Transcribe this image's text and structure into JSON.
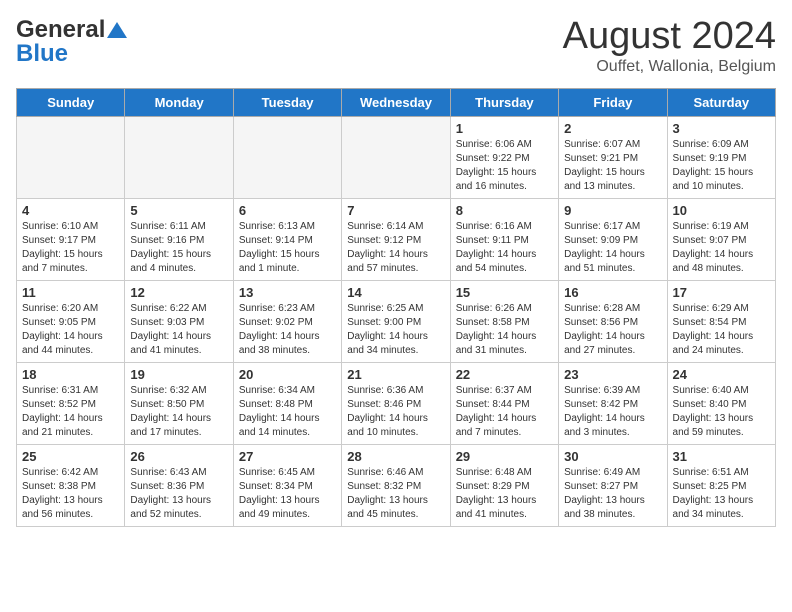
{
  "header": {
    "logo_general": "General",
    "logo_blue": "Blue",
    "month_title": "August 2024",
    "location": "Ouffet, Wallonia, Belgium"
  },
  "days_of_week": [
    "Sunday",
    "Monday",
    "Tuesday",
    "Wednesday",
    "Thursday",
    "Friday",
    "Saturday"
  ],
  "weeks": [
    [
      {
        "day": "",
        "info": ""
      },
      {
        "day": "",
        "info": ""
      },
      {
        "day": "",
        "info": ""
      },
      {
        "day": "",
        "info": ""
      },
      {
        "day": "1",
        "info": "Sunrise: 6:06 AM\nSunset: 9:22 PM\nDaylight: 15 hours\nand 16 minutes."
      },
      {
        "day": "2",
        "info": "Sunrise: 6:07 AM\nSunset: 9:21 PM\nDaylight: 15 hours\nand 13 minutes."
      },
      {
        "day": "3",
        "info": "Sunrise: 6:09 AM\nSunset: 9:19 PM\nDaylight: 15 hours\nand 10 minutes."
      }
    ],
    [
      {
        "day": "4",
        "info": "Sunrise: 6:10 AM\nSunset: 9:17 PM\nDaylight: 15 hours\nand 7 minutes."
      },
      {
        "day": "5",
        "info": "Sunrise: 6:11 AM\nSunset: 9:16 PM\nDaylight: 15 hours\nand 4 minutes."
      },
      {
        "day": "6",
        "info": "Sunrise: 6:13 AM\nSunset: 9:14 PM\nDaylight: 15 hours\nand 1 minute."
      },
      {
        "day": "7",
        "info": "Sunrise: 6:14 AM\nSunset: 9:12 PM\nDaylight: 14 hours\nand 57 minutes."
      },
      {
        "day": "8",
        "info": "Sunrise: 6:16 AM\nSunset: 9:11 PM\nDaylight: 14 hours\nand 54 minutes."
      },
      {
        "day": "9",
        "info": "Sunrise: 6:17 AM\nSunset: 9:09 PM\nDaylight: 14 hours\nand 51 minutes."
      },
      {
        "day": "10",
        "info": "Sunrise: 6:19 AM\nSunset: 9:07 PM\nDaylight: 14 hours\nand 48 minutes."
      }
    ],
    [
      {
        "day": "11",
        "info": "Sunrise: 6:20 AM\nSunset: 9:05 PM\nDaylight: 14 hours\nand 44 minutes."
      },
      {
        "day": "12",
        "info": "Sunrise: 6:22 AM\nSunset: 9:03 PM\nDaylight: 14 hours\nand 41 minutes."
      },
      {
        "day": "13",
        "info": "Sunrise: 6:23 AM\nSunset: 9:02 PM\nDaylight: 14 hours\nand 38 minutes."
      },
      {
        "day": "14",
        "info": "Sunrise: 6:25 AM\nSunset: 9:00 PM\nDaylight: 14 hours\nand 34 minutes."
      },
      {
        "day": "15",
        "info": "Sunrise: 6:26 AM\nSunset: 8:58 PM\nDaylight: 14 hours\nand 31 minutes."
      },
      {
        "day": "16",
        "info": "Sunrise: 6:28 AM\nSunset: 8:56 PM\nDaylight: 14 hours\nand 27 minutes."
      },
      {
        "day": "17",
        "info": "Sunrise: 6:29 AM\nSunset: 8:54 PM\nDaylight: 14 hours\nand 24 minutes."
      }
    ],
    [
      {
        "day": "18",
        "info": "Sunrise: 6:31 AM\nSunset: 8:52 PM\nDaylight: 14 hours\nand 21 minutes."
      },
      {
        "day": "19",
        "info": "Sunrise: 6:32 AM\nSunset: 8:50 PM\nDaylight: 14 hours\nand 17 minutes."
      },
      {
        "day": "20",
        "info": "Sunrise: 6:34 AM\nSunset: 8:48 PM\nDaylight: 14 hours\nand 14 minutes."
      },
      {
        "day": "21",
        "info": "Sunrise: 6:36 AM\nSunset: 8:46 PM\nDaylight: 14 hours\nand 10 minutes."
      },
      {
        "day": "22",
        "info": "Sunrise: 6:37 AM\nSunset: 8:44 PM\nDaylight: 14 hours\nand 7 minutes."
      },
      {
        "day": "23",
        "info": "Sunrise: 6:39 AM\nSunset: 8:42 PM\nDaylight: 14 hours\nand 3 minutes."
      },
      {
        "day": "24",
        "info": "Sunrise: 6:40 AM\nSunset: 8:40 PM\nDaylight: 13 hours\nand 59 minutes."
      }
    ],
    [
      {
        "day": "25",
        "info": "Sunrise: 6:42 AM\nSunset: 8:38 PM\nDaylight: 13 hours\nand 56 minutes."
      },
      {
        "day": "26",
        "info": "Sunrise: 6:43 AM\nSunset: 8:36 PM\nDaylight: 13 hours\nand 52 minutes."
      },
      {
        "day": "27",
        "info": "Sunrise: 6:45 AM\nSunset: 8:34 PM\nDaylight: 13 hours\nand 49 minutes."
      },
      {
        "day": "28",
        "info": "Sunrise: 6:46 AM\nSunset: 8:32 PM\nDaylight: 13 hours\nand 45 minutes."
      },
      {
        "day": "29",
        "info": "Sunrise: 6:48 AM\nSunset: 8:29 PM\nDaylight: 13 hours\nand 41 minutes."
      },
      {
        "day": "30",
        "info": "Sunrise: 6:49 AM\nSunset: 8:27 PM\nDaylight: 13 hours\nand 38 minutes."
      },
      {
        "day": "31",
        "info": "Sunrise: 6:51 AM\nSunset: 8:25 PM\nDaylight: 13 hours\nand 34 minutes."
      }
    ]
  ]
}
